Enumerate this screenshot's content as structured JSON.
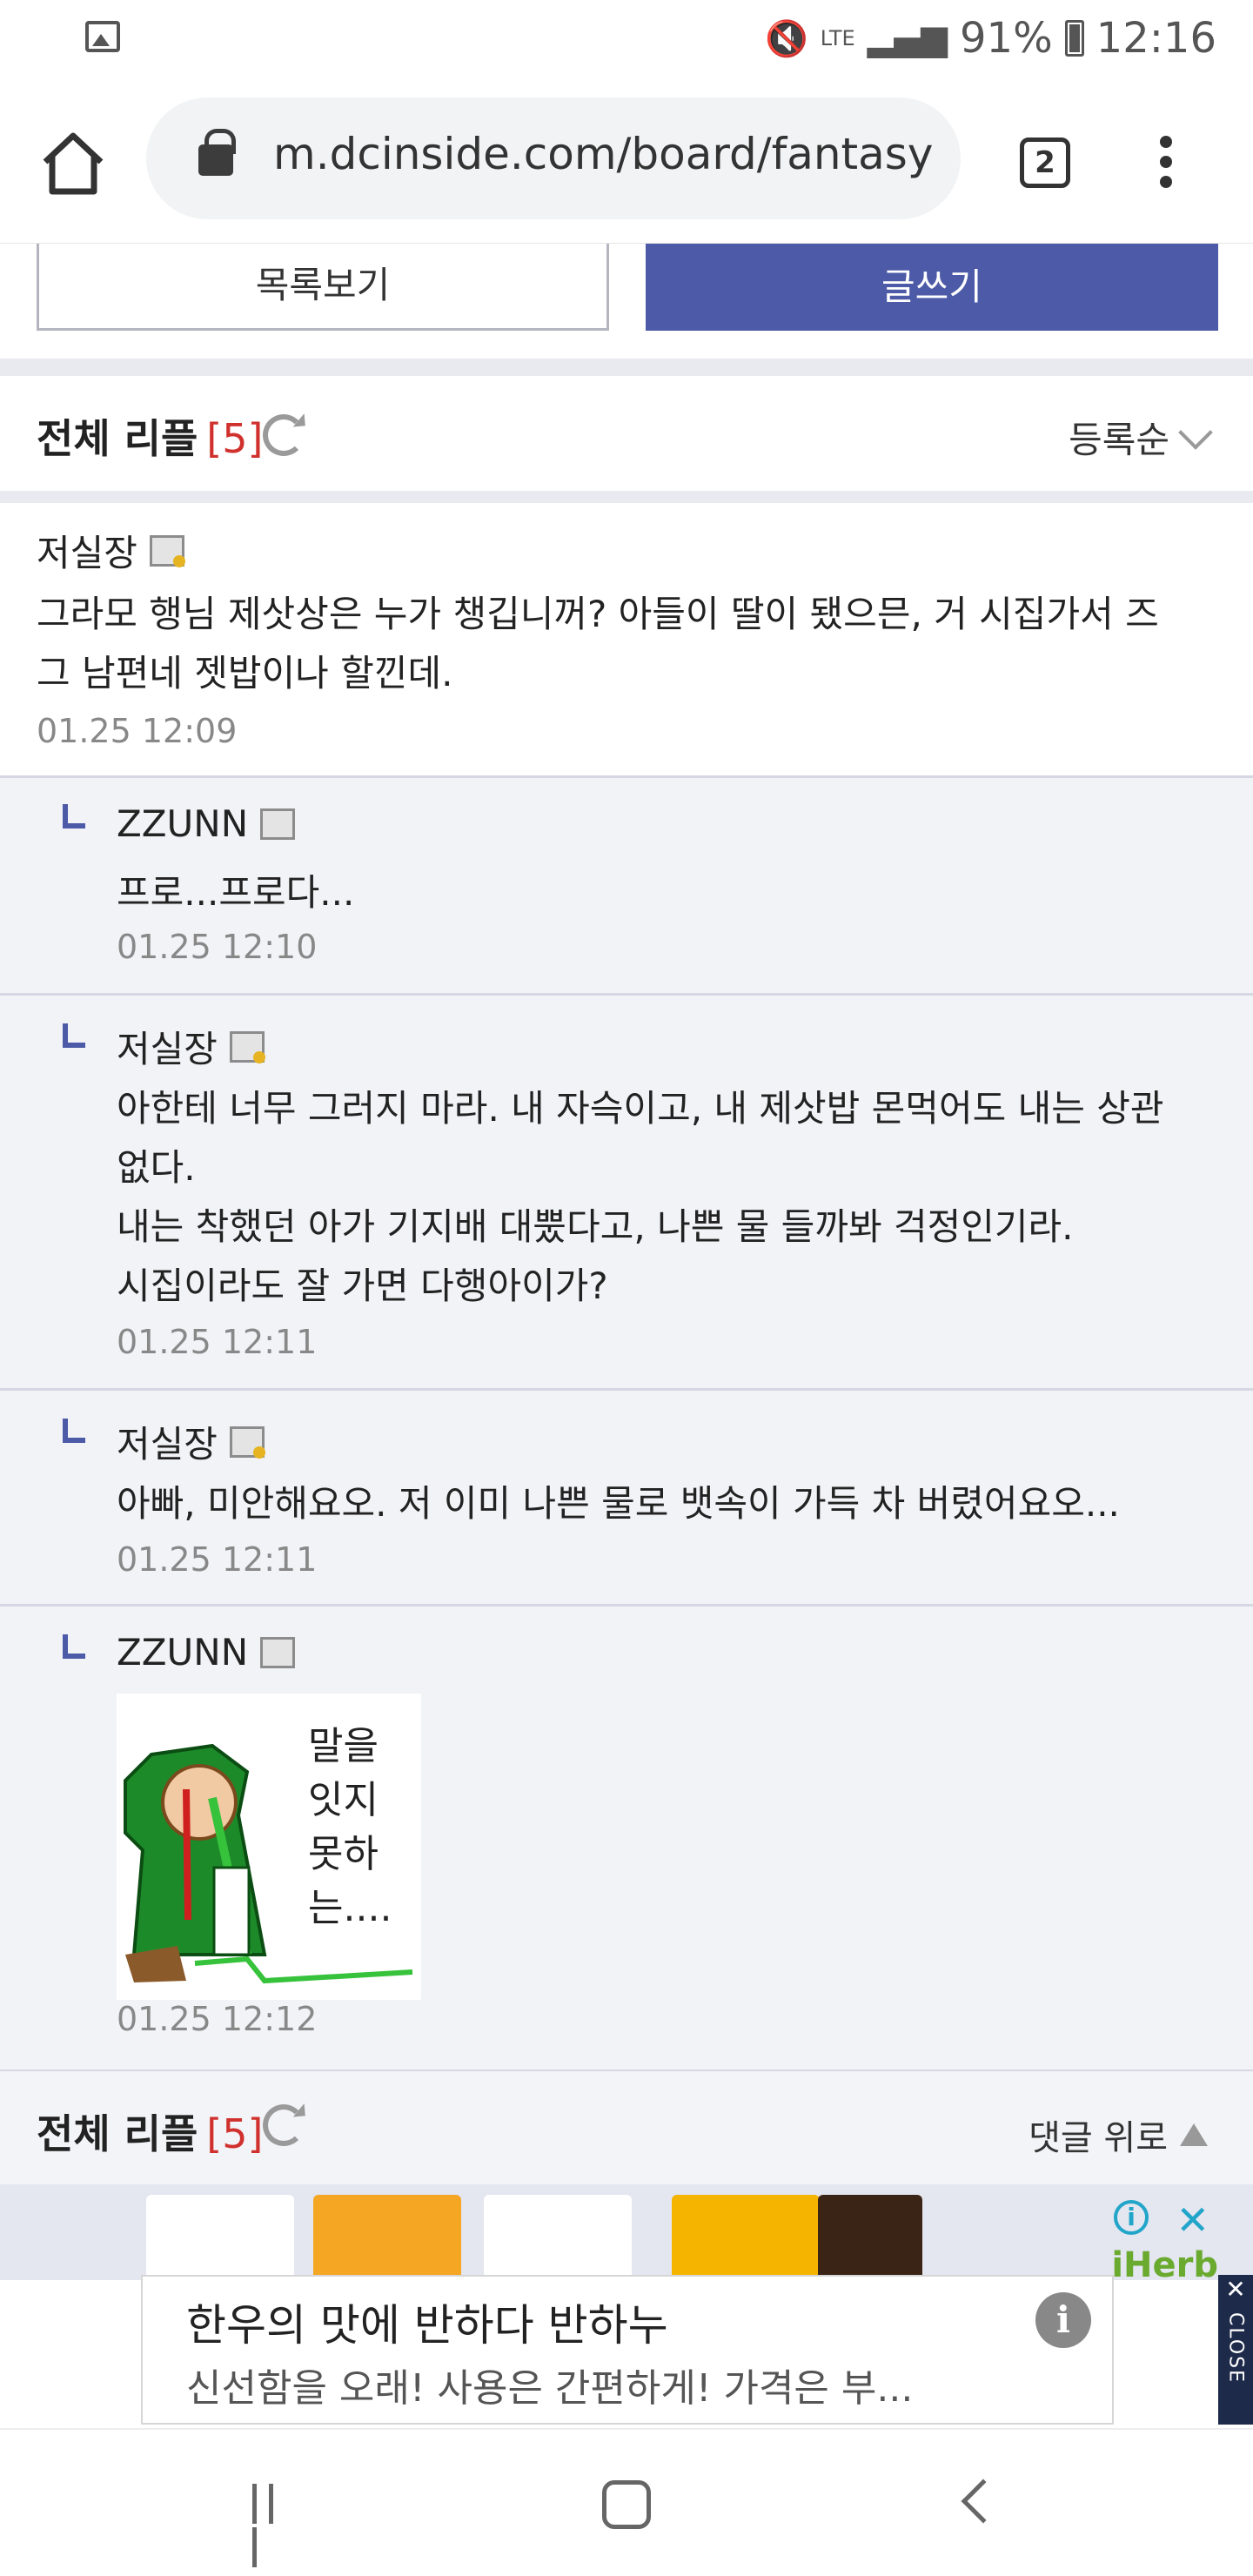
{
  "status_bar": {
    "battery": "91%",
    "time": "12:16",
    "network": "LTE"
  },
  "browser": {
    "url": "m.dcinside.com/board/fantasy",
    "tab_count": "2"
  },
  "actions": {
    "list_label": "목록보기",
    "write_label": "글쓰기"
  },
  "comment_header": {
    "title": "전체 리플",
    "count": "[5]",
    "sort_label": "등록순"
  },
  "comments": [
    {
      "nick": "저실장",
      "text_lines": [
        "그라모 행님 제삿상은 누가 챙깁니꺼? 아들이 딸이 됐으믄, 거 시집가서 즈",
        "그 남편네 젯밥이나 할낀데."
      ],
      "date": "01.25 12:09"
    },
    {
      "nick": "ZZUNN",
      "text_lines": [
        "프로...프로다..."
      ],
      "date": "01.25 12:10"
    },
    {
      "nick": "저실장",
      "text_lines": [
        "아한테 너무 그러지 마라. 내 자슥이고, 내 제삿밥 몬먹어도 내는 상관",
        "없다.",
        "내는 착했던 아가 기지배 대뿠다고, 나쁜 물 들까봐 걱정인기라.",
        "시집이라도 잘 가면 다행아이가?"
      ],
      "date": "01.25 12:11"
    },
    {
      "nick": "저실장",
      "text_lines": [
        "아빠, 미안해요오. 저 이미 나쁜 물로 뱃속이 가득 차 버렸어요오..."
      ],
      "date": "01.25 12:11"
    },
    {
      "nick": "ZZUNN",
      "dccon_text": "말을\n잇지\n못하\n는....",
      "date": "01.25 12:12"
    }
  ],
  "footer_header": {
    "title": "전체 리플",
    "count": "[5]",
    "reply_up_label": "댓글 위로"
  },
  "ad": {
    "brand": "iHerb",
    "title": "한우의 맛에 반하다 반하누",
    "description": "신선함을 오래! 사용은 간편하게! 가격은 부...",
    "side_close": "CLOSE"
  },
  "colors": {
    "accent": "#4c5aa7",
    "count_red": "#d0312d",
    "reply_bg": "#f2f3f7"
  }
}
